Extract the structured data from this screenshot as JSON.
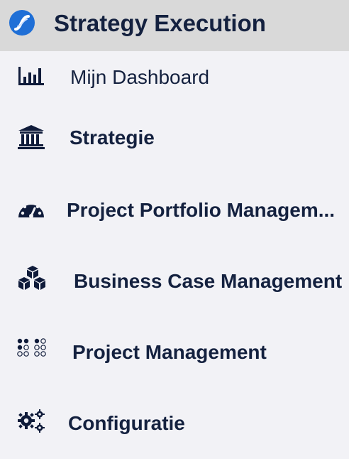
{
  "header": {
    "title": "Strategy Execution",
    "logo_icon": "app-logo-icon"
  },
  "nav": {
    "items": [
      {
        "label": "Mijn Dashboard",
        "icon": "bar-chart-icon"
      },
      {
        "label": "Strategie",
        "icon": "bank-icon"
      },
      {
        "label": "Project Portfolio Managem...",
        "icon": "gauge-icon"
      },
      {
        "label": "Business Case Management",
        "icon": "cubes-icon"
      },
      {
        "label": "Project Management",
        "icon": "dots-grid-icon"
      },
      {
        "label": "Configuratie",
        "icon": "gears-icon"
      }
    ]
  },
  "colors": {
    "header_bg": "#d9d9d9",
    "sidebar_bg": "#f2f2f6",
    "text": "#14213f",
    "logo_blue": "#1f6fd6",
    "icon_dark": "#0f1b3a"
  }
}
